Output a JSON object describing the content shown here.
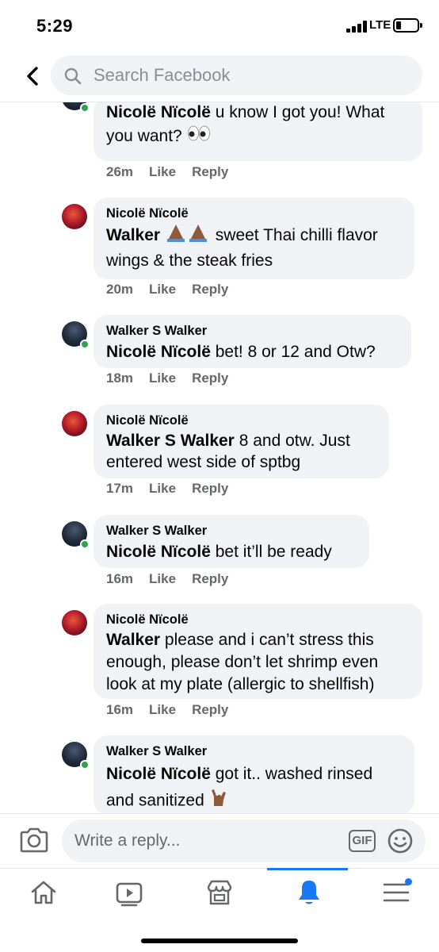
{
  "status_bar": {
    "time": "5:29",
    "network": "LTE"
  },
  "header": {
    "search_placeholder": "Search Facebook"
  },
  "comments": [
    {
      "author": "",
      "mention": "Nicolë Nïcolë",
      "text": " u know I got you! What you want? ",
      "emoji": "eyes",
      "time": "26m",
      "like": "Like",
      "reply": "Reply",
      "avatar": "walker"
    },
    {
      "author": "Nicolë Nïcolë",
      "mention": "Walker",
      "text": " sweet Thai chilli flavor wings & the steak fries",
      "emoji": "folded-hands",
      "time": "20m",
      "like": "Like",
      "reply": "Reply",
      "avatar": "nicole"
    },
    {
      "author": "Walker S Walker",
      "mention": "Nicolë Nïcolë",
      "text": " bet! 8 or 12 and Otw?",
      "time": "18m",
      "like": "Like",
      "reply": "Reply",
      "avatar": "walker"
    },
    {
      "author": "Nicolë Nïcolë",
      "mention": "Walker S Walker",
      "text": " 8 and otw. Just entered west side of sptbg",
      "time": "17m",
      "like": "Like",
      "reply": "Reply",
      "avatar": "nicole"
    },
    {
      "author": "Walker S Walker",
      "mention": "Nicolë Nïcolë",
      "text": " bet it’ll be ready",
      "time": "16m",
      "like": "Like",
      "reply": "Reply",
      "avatar": "walker"
    },
    {
      "author": "Nicolë Nïcolë",
      "mention": "Walker",
      "text": " please and i can’t stress this enough, please don’t let shrimp even look at my plate (allergic to shellfish)",
      "time": "16m",
      "like": "Like",
      "reply": "Reply",
      "avatar": "nicole"
    },
    {
      "author": "Walker S Walker",
      "mention": "Nicolë Nïcolë",
      "text": " got it.. washed rinsed and sanitized ",
      "emoji": "love-you-gesture",
      "time": "",
      "like": "",
      "reply": "",
      "avatar": "walker"
    }
  ],
  "reply_bar": {
    "placeholder": "Write a reply...",
    "gif_label": "GIF"
  },
  "tab_bar": {
    "tabs": [
      {
        "icon": "home-icon",
        "active": false
      },
      {
        "icon": "video-icon",
        "active": false
      },
      {
        "icon": "marketplace-icon",
        "active": false
      },
      {
        "icon": "bell-icon",
        "active": true
      },
      {
        "icon": "menu-icon",
        "active": false
      }
    ]
  },
  "colors": {
    "accent": "#1877f2",
    "bubble": "#f0f2f5",
    "meta": "#65676b",
    "online": "#31a24c"
  }
}
